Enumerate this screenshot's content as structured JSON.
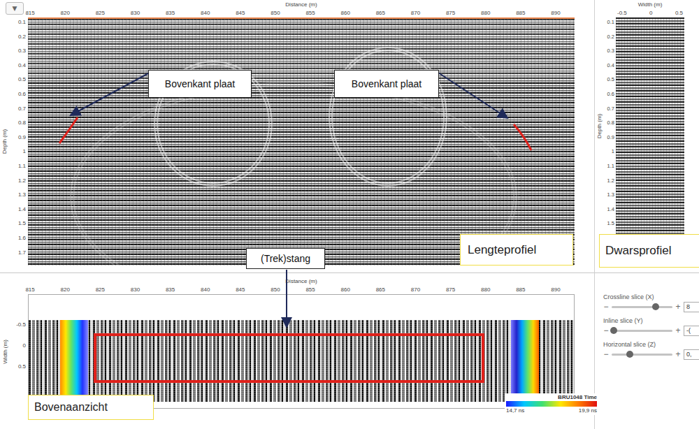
{
  "toolbar": {
    "menu_button": "▼"
  },
  "length_profile": {
    "title": "Distance (m)",
    "x_ticks": [
      "815",
      "820",
      "825",
      "830",
      "835",
      "840",
      "845",
      "850",
      "855",
      "860",
      "865",
      "870",
      "875",
      "880",
      "885",
      "890"
    ],
    "depth_title": "Depth (m)",
    "depth_ticks": [
      "0.1",
      "0.2",
      "0.3",
      "0.4",
      "0.5",
      "0.6",
      "0.7",
      "0.8",
      "0.9",
      "1",
      "1.1",
      "1.2",
      "1.3",
      "1.4",
      "1.5",
      "1.6",
      "1.7"
    ],
    "label": "Lengteprofiel"
  },
  "cross_profile": {
    "title": "Width (m)",
    "width_ticks": [
      "-0.5",
      "0",
      "0.5"
    ],
    "depth_title": "Depth (m)",
    "depth_ticks": [
      "0.1",
      "0.2",
      "0.3",
      "0.4",
      "0.5",
      "0.6",
      "0.7",
      "0.8",
      "0.9",
      "1",
      "1.1",
      "1.2",
      "1.3",
      "1.4",
      "1.5"
    ],
    "label": "Dwarsprofiel"
  },
  "top_view": {
    "title": "Distance (m)",
    "x_ticks": [
      "815",
      "820",
      "825",
      "830",
      "835",
      "840",
      "845",
      "850",
      "855",
      "860",
      "865",
      "870",
      "875",
      "880",
      "885",
      "890"
    ],
    "width_title": "Width (m)",
    "width_ticks": [
      "-0.5",
      "0",
      "0.5"
    ],
    "label": "Bovenaanzicht",
    "colorbar": {
      "title": "BRU1048 Time",
      "min": "14,7 ns",
      "max": "19,9 ns"
    }
  },
  "slices": [
    {
      "label": "Crossline slice (X)",
      "minus": "−",
      "plus": "+",
      "value": "8",
      "level": 0.72
    },
    {
      "label": "Inline slice (Y)",
      "minus": "−",
      "plus": "+",
      "value": "-(",
      "level": 0.04
    },
    {
      "label": "Horizontal slice (Z)",
      "minus": "−",
      "plus": "+",
      "value": "0,",
      "level": 0.3
    }
  ],
  "annotations": {
    "plate_left": "Bovenkant plaat",
    "plate_right": "Bovenkant plaat",
    "rod": "(Trek)stang"
  }
}
